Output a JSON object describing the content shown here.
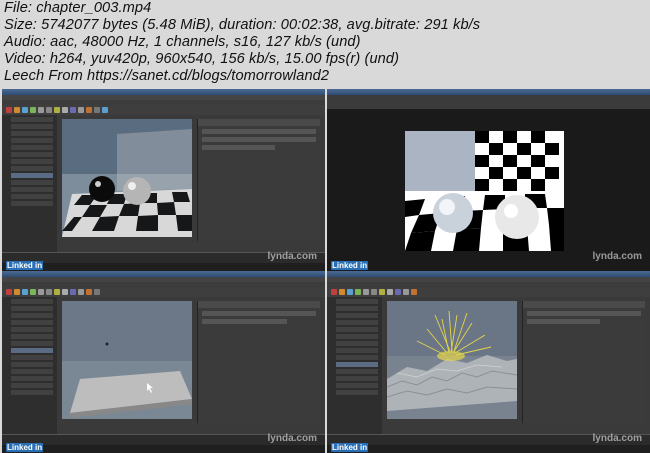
{
  "file_info": {
    "line1": "File: chapter_003.mp4",
    "line2": "Size: 5742077 bytes (5.48 MiB), duration: 00:02:38, avg.bitrate: 291 kb/s",
    "line3": "Audio: aac, 48000 Hz, 1 channels, s16, 127 kb/s (und)",
    "line4": "Video: h264, yuv420p, 960x540, 156 kb/s, 15.00 fps(r) (und)",
    "line5": "Leech From https://sanet.cd/blogs/tomorrowland2"
  },
  "thumbnails": [
    {
      "watermark": "lynda.com",
      "corner_label": "Linked in"
    },
    {
      "watermark": "lynda.com",
      "corner_label": "Linked in"
    },
    {
      "watermark": "lynda.com",
      "corner_label": "Linked in"
    },
    {
      "watermark": "lynda.com",
      "corner_label": "Linked in"
    }
  ],
  "colors": {
    "background": "#d9d9d9",
    "maya_ui": "#3a3a3a",
    "title_bar": "#3d5d87"
  }
}
